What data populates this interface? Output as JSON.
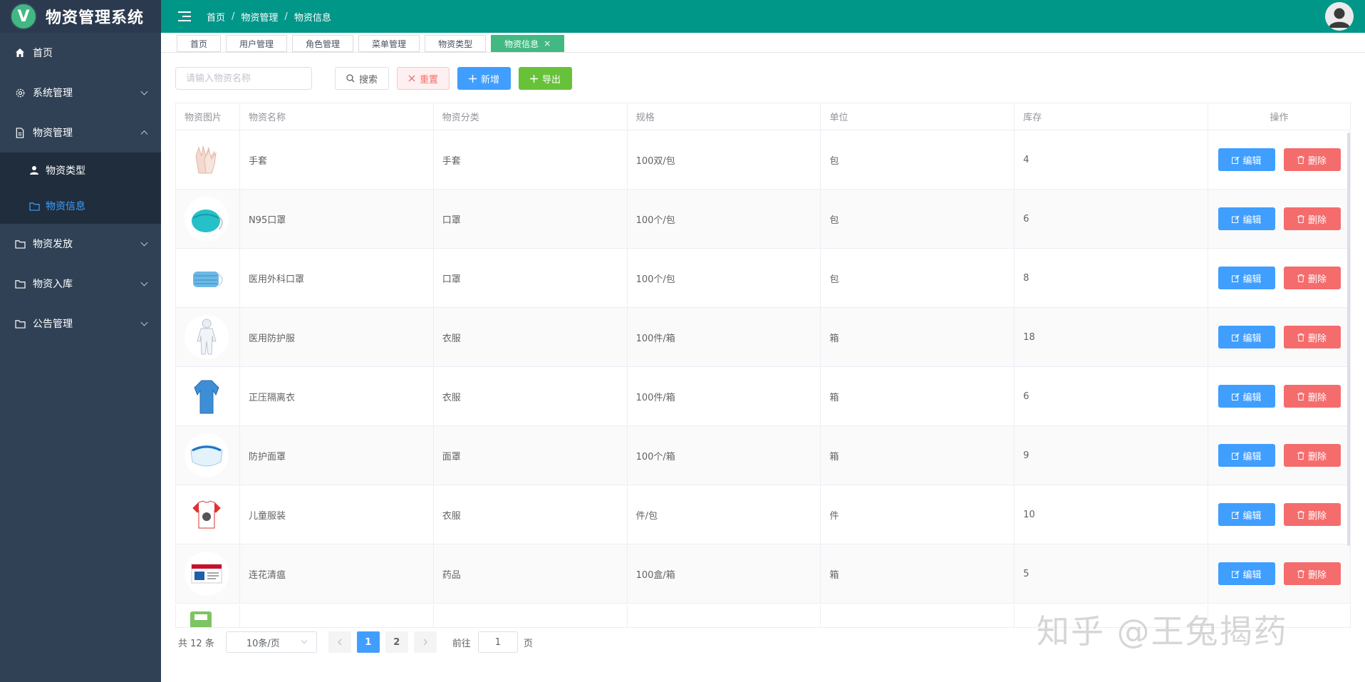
{
  "brand": {
    "logo_letter": "V",
    "title": "物资管理系统"
  },
  "sidebar": {
    "items": [
      {
        "label": "首页",
        "icon": "home-icon"
      },
      {
        "label": "系统管理",
        "icon": "gear-icon"
      },
      {
        "label": "物资管理",
        "icon": "document-icon",
        "expanded": true,
        "children": [
          {
            "label": "物资类型",
            "icon": "user-icon"
          },
          {
            "label": "物资信息",
            "icon": "folder-icon",
            "active": true
          }
        ]
      },
      {
        "label": "物资发放",
        "icon": "folder-icon"
      },
      {
        "label": "物资入库",
        "icon": "folder-icon"
      },
      {
        "label": "公告管理",
        "icon": "folder-icon"
      }
    ]
  },
  "header": {
    "breadcrumb": [
      "首页",
      "物资管理",
      "物资信息"
    ],
    "separator": "/"
  },
  "tabs": [
    {
      "label": "首页"
    },
    {
      "label": "用户管理"
    },
    {
      "label": "角色管理"
    },
    {
      "label": "菜单管理"
    },
    {
      "label": "物资类型"
    },
    {
      "label": "物资信息",
      "active": true,
      "close": "×"
    }
  ],
  "toolbar": {
    "search_placeholder": "请输入物资名称",
    "search_label": "搜索",
    "reset_label": "重置",
    "add_label": "新增",
    "export_label": "导出"
  },
  "table": {
    "columns": [
      "物资图片",
      "物资名称",
      "物资分类",
      "规格",
      "单位",
      "库存",
      "操作"
    ],
    "edit_label": "编辑",
    "delete_label": "删除",
    "rows": [
      {
        "image": "gloves",
        "name": "手套",
        "category": "手套",
        "spec": "100双/包",
        "unit": "包",
        "stock": "4"
      },
      {
        "image": "n95-mask",
        "name": "N95口罩",
        "category": "口罩",
        "spec": "100个/包",
        "unit": "包",
        "stock": "6"
      },
      {
        "image": "surgical-mask",
        "name": "医用外科口罩",
        "category": "口罩",
        "spec": "100个/包",
        "unit": "包",
        "stock": "8"
      },
      {
        "image": "protective-suit",
        "name": "医用防护服",
        "category": "衣服",
        "spec": "100件/箱",
        "unit": "箱",
        "stock": "18"
      },
      {
        "image": "isolation-gown",
        "name": "正压隔离衣",
        "category": "衣服",
        "spec": "100件/箱",
        "unit": "箱",
        "stock": "6"
      },
      {
        "image": "face-shield",
        "name": "防护面罩",
        "category": "面罩",
        "spec": "100个/箱",
        "unit": "箱",
        "stock": "9"
      },
      {
        "image": "kids-clothing",
        "name": "儿童服装",
        "category": "衣服",
        "spec": "件/包",
        "unit": "件",
        "stock": "10"
      },
      {
        "image": "medicine-box",
        "name": "连花清瘟",
        "category": "药品",
        "spec": "100盒/箱",
        "unit": "箱",
        "stock": "5"
      }
    ]
  },
  "pagination": {
    "total_text": "共 12 条",
    "page_size": "10条/页",
    "pages": [
      "1",
      "2"
    ],
    "current": "1",
    "goto_label": "前往",
    "goto_value": "1",
    "page_suffix": "页"
  },
  "watermark": "知乎 @王兔揭药",
  "colors": {
    "sidebar_bg": "#304156",
    "submenu_bg": "#1f2d3d",
    "header_bg": "#009688",
    "active_tab": "#42b983",
    "primary": "#409eff",
    "danger": "#f56c6c",
    "success": "#67c23a"
  }
}
